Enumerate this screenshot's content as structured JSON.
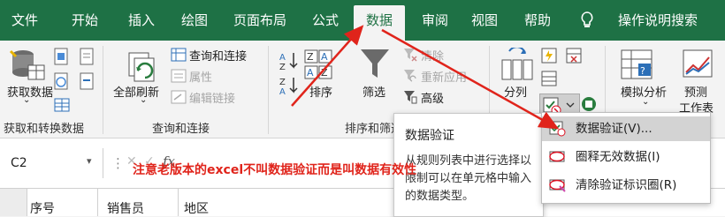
{
  "tabs": [
    "文件",
    "开始",
    "插入",
    "绘图",
    "页面布局",
    "公式",
    "数据",
    "审阅",
    "视图",
    "帮助",
    "操作说明搜索"
  ],
  "ribbon": {
    "get_data": "获取数据",
    "get_transform_group": "获取和转换数据",
    "refresh_all": "全部刷新",
    "queries_connections": "查询和连接",
    "properties": "属性",
    "edit_links": "编辑链接",
    "queries_group": "查询和连接",
    "sort": "排序",
    "filter": "筛选",
    "clear": "清除",
    "reapply": "重新应用",
    "advanced": "高级",
    "sort_filter_group": "排序和筛选",
    "split": "分列",
    "what_if": "模拟分析",
    "forecast_line1": "预测",
    "forecast_line2": "工作表"
  },
  "formula": {
    "namebox": "C2",
    "fx": "fx"
  },
  "grid": {
    "col_a": "序号",
    "col_b": "销售员",
    "col_c": "地区"
  },
  "tooltip": {
    "title": "数据验证",
    "body": "从规则列表中进行选择以限制可以在单元格中输入的数据类型。"
  },
  "menu": {
    "items": [
      "数据验证(V)...",
      "圈释无效数据(I)",
      "清除验证标识圈(R)"
    ]
  },
  "annotation": "注意老版本的excel不叫数据验证而是叫数据有效性",
  "colors": {
    "excel_green": "#1e7145",
    "arrow_red": "#e0241b"
  }
}
